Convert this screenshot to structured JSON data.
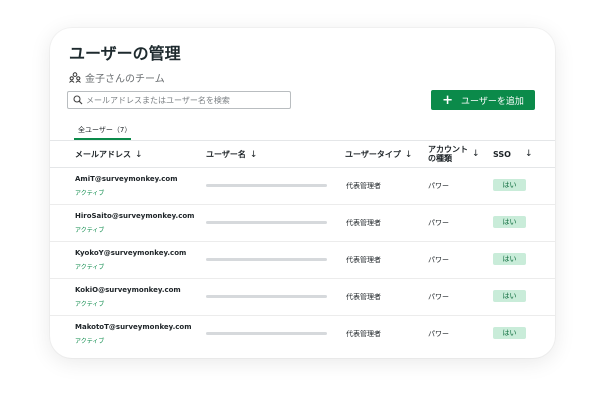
{
  "page": {
    "title": "ユーザーの管理",
    "team_name": "金子さんのチーム"
  },
  "search": {
    "placeholder": "メールアドレスまたはユーザー名を検索"
  },
  "add_button": {
    "label": "ユーザーを追加"
  },
  "tabs": [
    {
      "label": "全ユーザー（7）",
      "active": true
    }
  ],
  "table": {
    "columns": {
      "email": "メールアドレス",
      "username": "ユーザー名",
      "user_type": "ユーザータイプ",
      "account_type_line1": "アカウント",
      "account_type_line2": "の種類",
      "sso": "SSO"
    },
    "rows": [
      {
        "email": "AmiT@surveymonkey.com",
        "status": "アクティブ",
        "user_type": "代表管理者",
        "account_type": "パワー",
        "sso": "はい"
      },
      {
        "email": "HiroSaito@surveymonkey.com",
        "status": "アクティブ",
        "user_type": "代表管理者",
        "account_type": "パワー",
        "sso": "はい"
      },
      {
        "email": "KyokoY@surveymonkey.com",
        "status": "アクティブ",
        "user_type": "代表管理者",
        "account_type": "パワー",
        "sso": "はい"
      },
      {
        "email": "KokiO@surveymonkey.com",
        "status": "アクティブ",
        "user_type": "代表管理者",
        "account_type": "パワー",
        "sso": "はい"
      },
      {
        "email": "MakotoT@surveymonkey.com",
        "status": "アクティブ",
        "user_type": "代表管理者",
        "account_type": "パワー",
        "sso": "はい"
      }
    ]
  },
  "icons": {
    "team": "team-icon",
    "search": "search-icon",
    "add": "plus-icon",
    "sort": "sort-arrow-down-icon"
  },
  "colors": {
    "accent": "#0b8a4a",
    "badge_bg": "#c9ecd9",
    "badge_text": "#0a6a3a"
  }
}
